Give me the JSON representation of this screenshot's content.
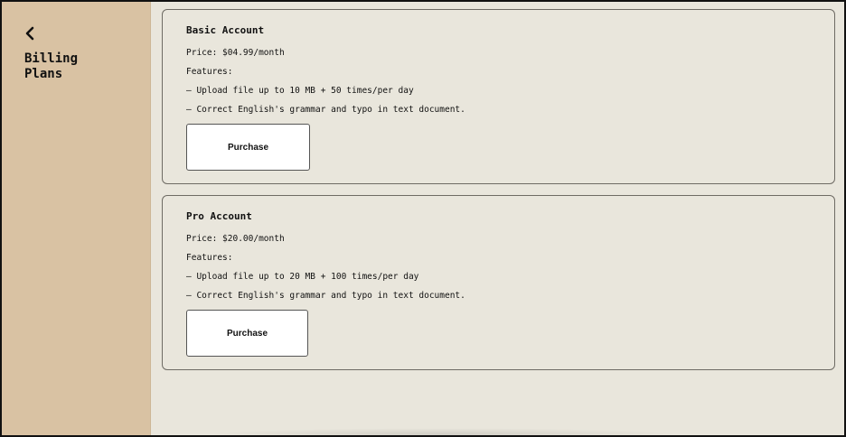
{
  "sidebar": {
    "back_icon": "chevron-left-icon",
    "title": "Billing\nPlans"
  },
  "plans": [
    {
      "name": "Basic Account",
      "price": "Price: $04.99/month",
      "features_label": "Features:",
      "features": [
        "– Upload file up to 10 MB + 50 times/per day",
        "– Correct English's grammar and typo in text document."
      ],
      "button_label": "Purchase"
    },
    {
      "name": "Pro Account",
      "price": "Price: $20.00/month",
      "features_label": "Features:",
      "features": [
        "– Upload file up to 20 MB + 100 times/per day",
        "– Correct English's grammar and typo in text document."
      ],
      "button_label": "Purchase"
    }
  ]
}
